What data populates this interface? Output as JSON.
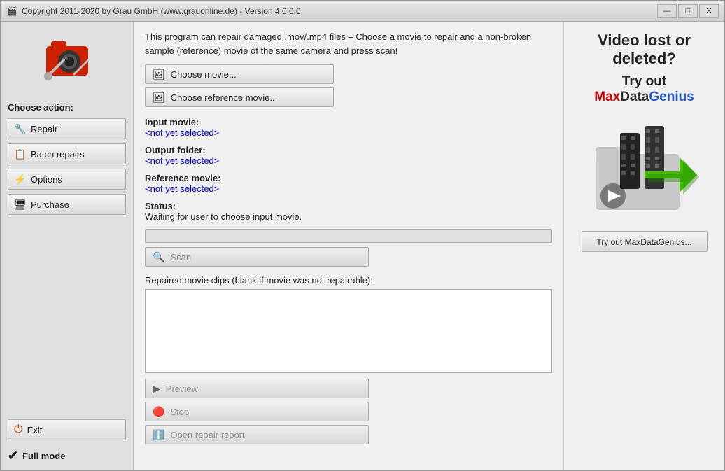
{
  "window": {
    "title": "Copyright 2011-2020 by Grau GmbH (www.grauonline.de) - Version 4.0.0.0"
  },
  "titlebar": {
    "minimize": "—",
    "maximize": "□",
    "close": "✕"
  },
  "sidebar": {
    "choose_action_label": "Choose action:",
    "buttons": [
      {
        "id": "repair",
        "label": "Repair",
        "icon": "🔧"
      },
      {
        "id": "batch-repairs",
        "label": "Batch repairs",
        "icon": "📋"
      },
      {
        "id": "options",
        "label": "Options",
        "icon": "⚡"
      },
      {
        "id": "purchase",
        "label": "Purchase",
        "icon": "🖥"
      }
    ],
    "exit_label": "Exit",
    "exit_icon": "⏻",
    "full_mode_label": "Full mode"
  },
  "main": {
    "description": "This program can repair damaged .mov/.mp4 files – Choose a movie to repair and a non-broken sample (reference) movie of the same camera and press scan!",
    "choose_movie_btn": "Choose movie...",
    "choose_reference_btn": "Choose reference movie...",
    "input_movie_label": "Input movie:",
    "input_movie_value": "<not yet selected>",
    "output_folder_label": "Output folder:",
    "output_folder_value": "<not yet selected>",
    "reference_movie_label": "Reference movie:",
    "reference_movie_value": "<not yet selected>",
    "status_label": "Status:",
    "status_value": "Waiting for user to choose input movie.",
    "scan_btn": "Scan",
    "repaired_label": "Repaired movie clips (blank if movie was not repairable):",
    "preview_btn": "Preview",
    "stop_btn": "Stop",
    "open_report_btn": "Open repair report"
  },
  "ad": {
    "title": "Video lost or\ndeleted?",
    "subtitle_try": "Try out",
    "subtitle_brand1": "Max",
    "subtitle_brand2": "Data",
    "subtitle_brand3": "Genius",
    "try_btn": "Try out MaxDataGenius..."
  }
}
